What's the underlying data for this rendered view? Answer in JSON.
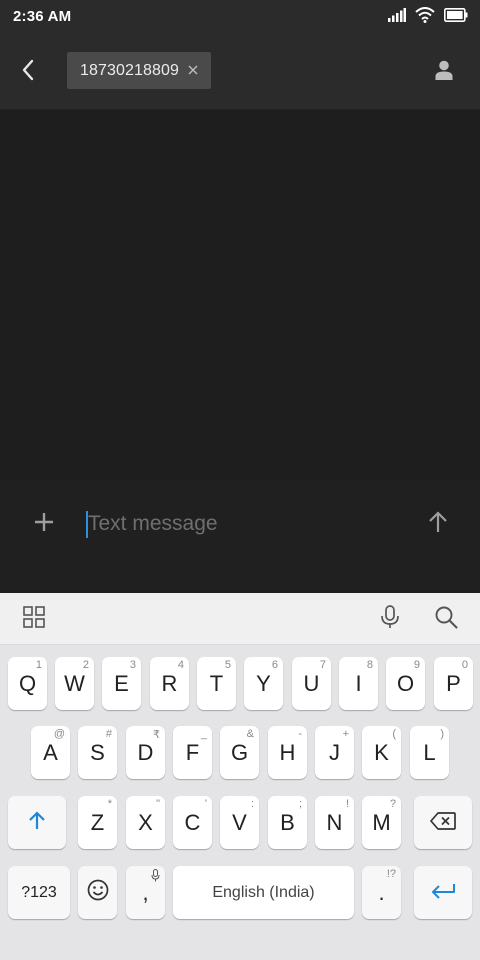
{
  "status_bar": {
    "time": "2:36 AM",
    "icons": [
      "signal-icon",
      "wifi-icon",
      "battery-icon"
    ]
  },
  "header": {
    "back_icon": "chevron-left-icon",
    "recipient": "18730218809",
    "recipient_remove_icon": "close-icon",
    "contact_icon": "person-icon"
  },
  "compose": {
    "attach_icon": "plus-icon",
    "placeholder": "Text message",
    "value": "",
    "send_icon": "arrow-up-icon"
  },
  "keyboard_toolbar": {
    "left_icon": "grid-icon",
    "mic_icon": "mic-icon",
    "search_icon": "search-icon"
  },
  "keyboard": {
    "row1": [
      {
        "key": "Q",
        "hint": "1"
      },
      {
        "key": "W",
        "hint": "2"
      },
      {
        "key": "E",
        "hint": "3"
      },
      {
        "key": "R",
        "hint": "4"
      },
      {
        "key": "T",
        "hint": "5"
      },
      {
        "key": "Y",
        "hint": "6"
      },
      {
        "key": "U",
        "hint": "7"
      },
      {
        "key": "I",
        "hint": "8"
      },
      {
        "key": "O",
        "hint": "9"
      },
      {
        "key": "P",
        "hint": "0"
      }
    ],
    "row2": [
      {
        "key": "A",
        "hint": "@"
      },
      {
        "key": "S",
        "hint": "#"
      },
      {
        "key": "D",
        "hint": "₹"
      },
      {
        "key": "F",
        "hint": "_"
      },
      {
        "key": "G",
        "hint": "&"
      },
      {
        "key": "H",
        "hint": "-"
      },
      {
        "key": "J",
        "hint": "+"
      },
      {
        "key": "K",
        "hint": "("
      },
      {
        "key": "L",
        "hint": ")"
      }
    ],
    "row3": [
      {
        "key": "Z",
        "hint": "*"
      },
      {
        "key": "X",
        "hint": "\""
      },
      {
        "key": "C",
        "hint": "'"
      },
      {
        "key": "V",
        "hint": ":"
      },
      {
        "key": "B",
        "hint": ";"
      },
      {
        "key": "N",
        "hint": "!"
      },
      {
        "key": "M",
        "hint": "?"
      }
    ],
    "shift_icon": "shift-arrow-icon",
    "backspace_icon": "backspace-icon",
    "symbols_label": "?123",
    "emoji_icon": "emoji-icon",
    "comma_label": ",",
    "comma_hint_icon": "mic-icon",
    "space_label": "English (India)",
    "period_label": ".",
    "period_hint": "!?",
    "enter_icon": "enter-icon"
  },
  "colors": {
    "accent": "#2f8fd8",
    "background": "#1e1e1e",
    "header": "#2b2b2b"
  }
}
